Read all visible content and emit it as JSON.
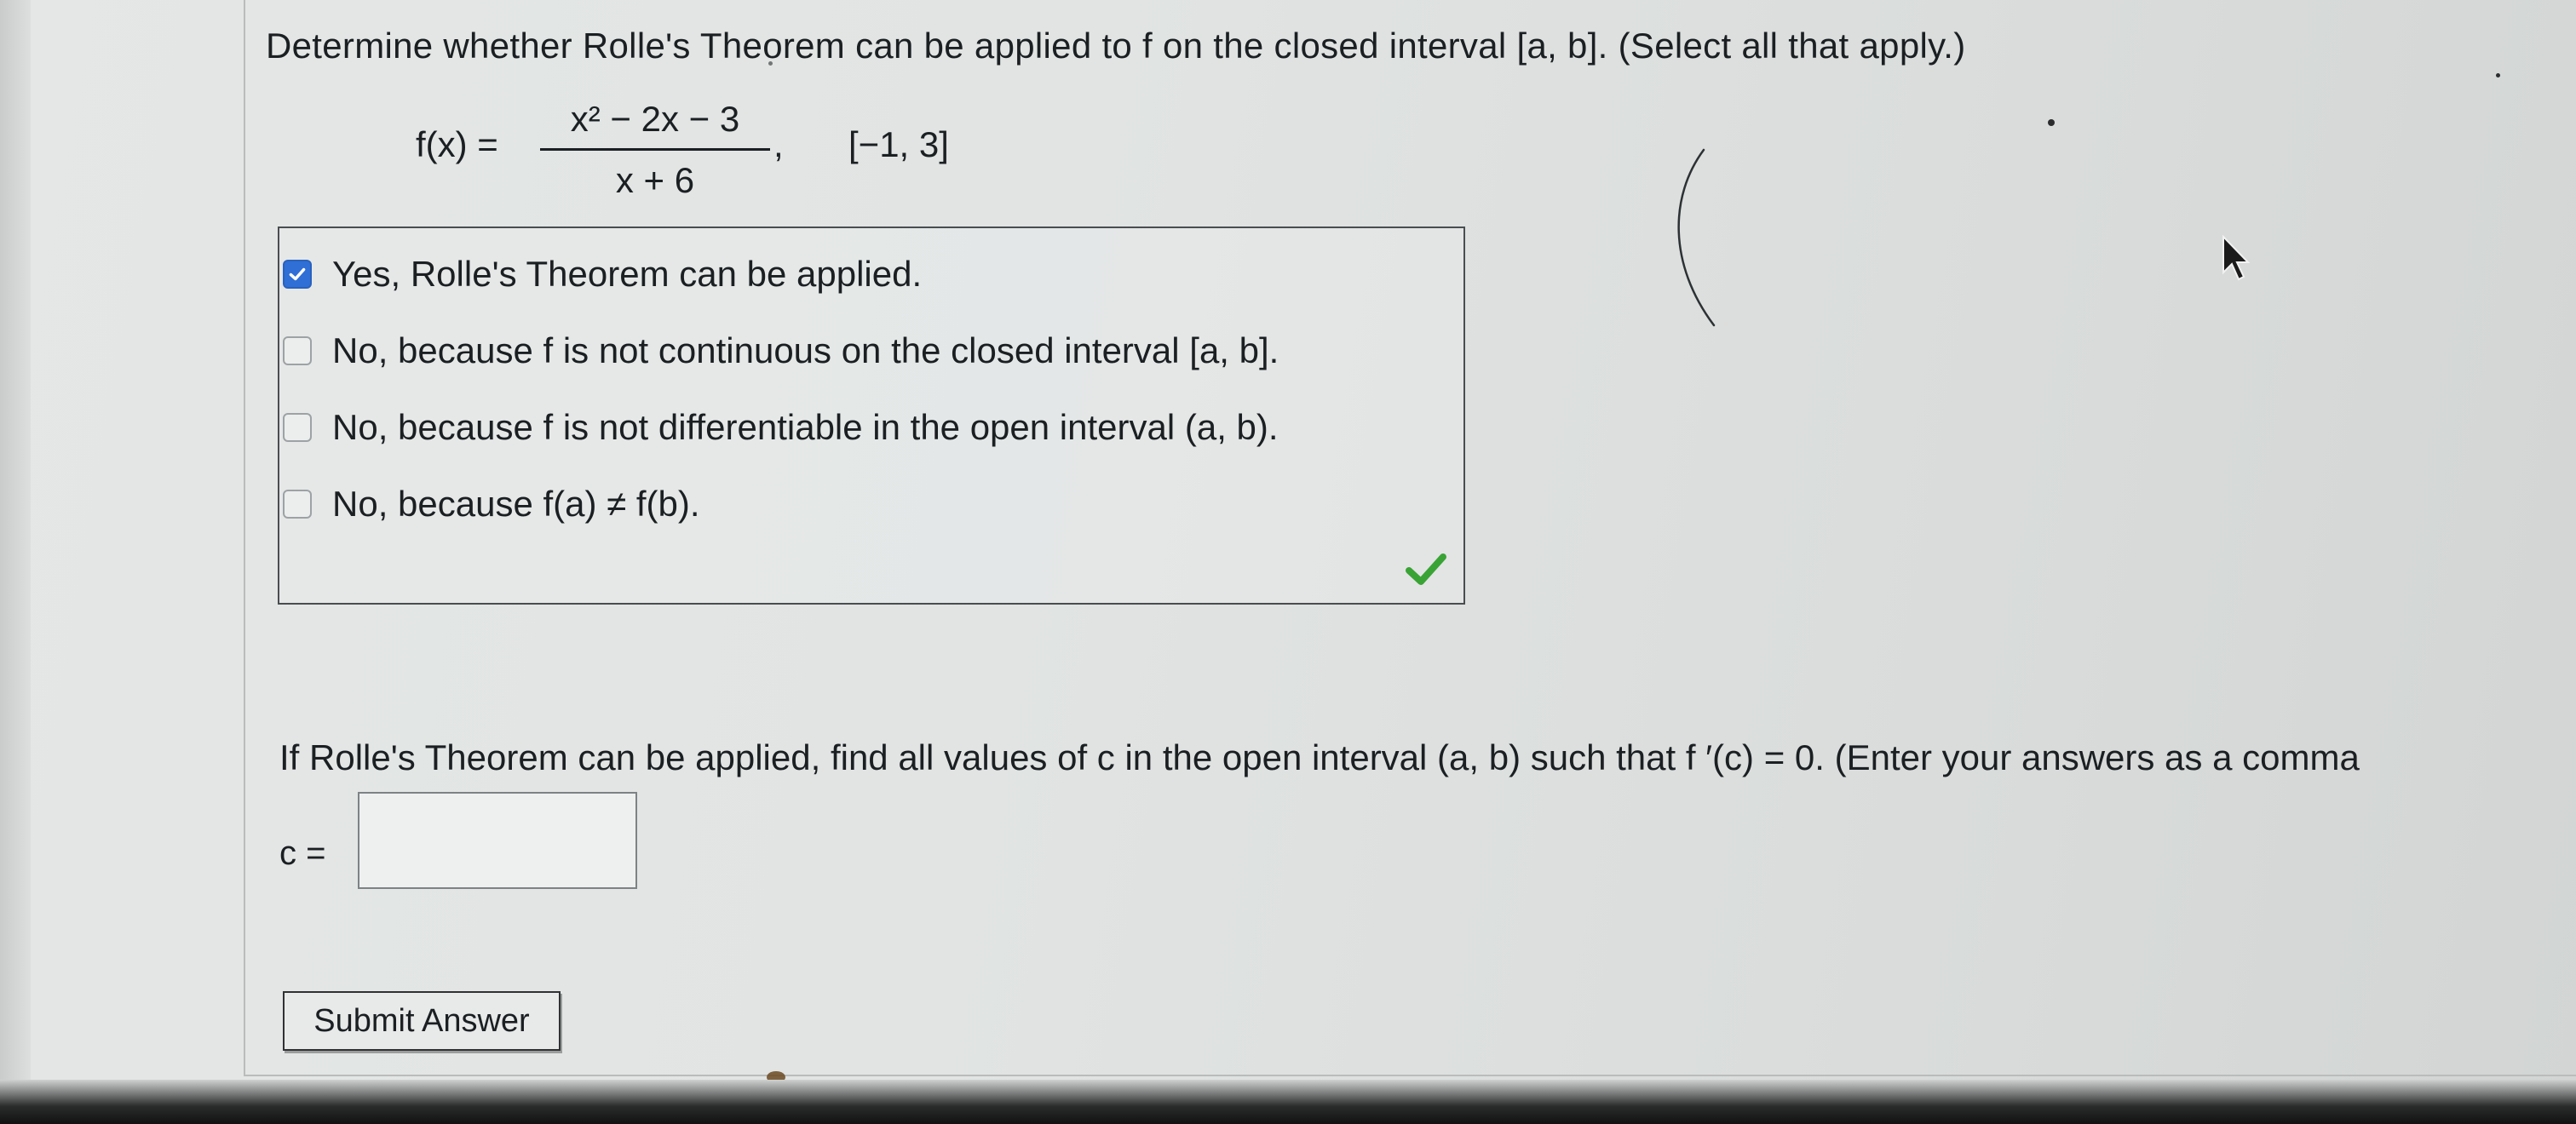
{
  "question": {
    "prompt": "Determine whether Rolle's Theorem can be applied to f on the closed interval [a, b]. (Select all that apply.)",
    "function_label": "f(x) =",
    "numerator": "x² − 2x − 3",
    "denominator": "x + 6",
    "separator": ",",
    "interval": "[−1, 3]"
  },
  "options": [
    {
      "label": "Yes, Rolle's Theorem can be applied.",
      "checked": true
    },
    {
      "label": "No, because f is not continuous on the closed interval [a, b].",
      "checked": false
    },
    {
      "label": "No, because f is not differentiable in the open interval (a, b).",
      "checked": false
    },
    {
      "label": "No, because f(a) ≠ f(b).",
      "checked": false
    }
  ],
  "feedback": {
    "status": "correct",
    "icon": "green-checkmark-icon",
    "color": "#3aa335"
  },
  "followup": {
    "prompt": "If Rolle's Theorem can be applied, find all values of c in the open interval (a, b) such that f ′(c) = 0. (Enter your answers as a comma",
    "answer_label": "c =",
    "answer_value": ""
  },
  "submit_label": "Submit Answer",
  "colors": {
    "checkbox_checked": "#2f6fd6",
    "text": "#1c1f22",
    "border": "#4a4d4f"
  }
}
